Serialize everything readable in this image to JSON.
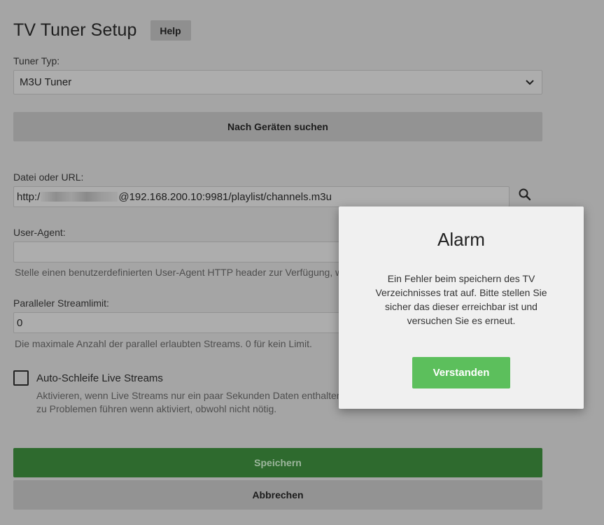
{
  "header": {
    "title": "TV Tuner Setup",
    "help_label": "Help"
  },
  "tuner_type": {
    "label": "Tuner Typ:",
    "selected": "M3U Tuner"
  },
  "scan_button": "Nach Geräten suchen",
  "file_url": {
    "label": "Datei oder URL:",
    "value_prefix": "http:/",
    "value_suffix": "@192.168.200.10:9981/playlist/channels.m3u"
  },
  "user_agent": {
    "label": "User-Agent:",
    "value": "",
    "help": "Stelle einen benutzerdefinierten User-Agent HTTP header zur Verfügung, w"
  },
  "stream_limit": {
    "label": "Paralleler Streamlimit:",
    "value": "0",
    "help": "Die maximale Anzahl der parallel erlaubten Streams. 0 für kein Limit."
  },
  "auto_loop": {
    "label": "Auto-Schleife Live Streams",
    "checked": false,
    "help_line1": "Aktivieren, wenn Live Streams nur ein paar Sekunden Daten enthalten",
    "help_line2": "zu Problemen führen wenn aktiviert, obwohl nicht nötig."
  },
  "save_label": "Speichern",
  "cancel_label": "Abbrechen",
  "modal": {
    "title": "Alarm",
    "message": "Ein Fehler beim speichern des TV Verzeichnisses trat auf. Bitte stellen Sie sicher das dieser erreichbar ist und versuchen Sie es erneut.",
    "confirm_label": "Verstanden"
  },
  "colors": {
    "overlay_background": "#a5a5a5",
    "save_button": "#2e6a2e",
    "modal_confirm": "#5cbf5c",
    "modal_background": "#f0f0f0"
  },
  "icons": {
    "select_chevron": "chevron-down-icon",
    "url_search": "search-icon"
  }
}
